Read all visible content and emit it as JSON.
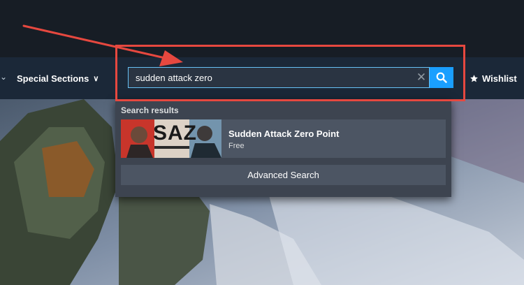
{
  "nav": {
    "special_sections_label": "Special Sections",
    "wishlist_label": "Wishlist"
  },
  "search": {
    "value": "sudden attack zero",
    "placeholder": "search"
  },
  "dropdown": {
    "results_label": "Search results",
    "result": {
      "name": "Sudden Attack Zero Point",
      "price": "Free",
      "thumb_text": "SAZ"
    },
    "advanced_label": "Advanced Search"
  },
  "colors": {
    "accent": "#1a9fff",
    "annotation": "#e6483f"
  }
}
